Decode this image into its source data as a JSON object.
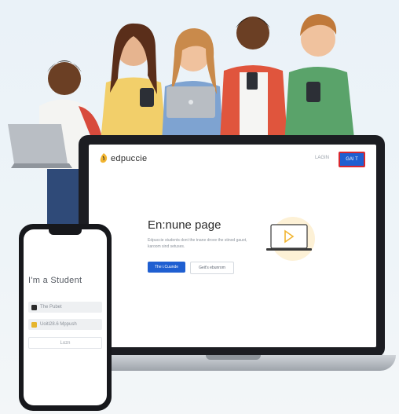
{
  "laptop": {
    "brand": "edpuccie",
    "login_link": "LAGIN",
    "get_button": "GAI T",
    "hero_title": "En:nune page",
    "hero_text": "Edpuccie students dont the tnane drove the stinod gauot, karoom sind setuses.",
    "primary_button": "The i.Cuunde",
    "secondary_button": "Geit's ebunrom"
  },
  "phone": {
    "title": "I'm a Student",
    "field1": "The Pubet",
    "field2": "Uoiti28.6 Mppush",
    "login_button": "Lozn"
  },
  "colors": {
    "accent": "#1f5fd1",
    "highlight": "#d9272e",
    "illustration": "#f2b531"
  }
}
